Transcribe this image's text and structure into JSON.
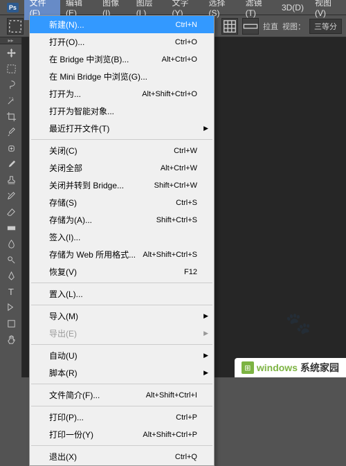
{
  "app": {
    "logo": "Ps"
  },
  "menubar": [
    {
      "label": "文件(F)",
      "active": true
    },
    {
      "label": "编辑(E)"
    },
    {
      "label": "图像(I)"
    },
    {
      "label": "图层(L)"
    },
    {
      "label": "文字(Y)"
    },
    {
      "label": "选择(S)"
    },
    {
      "label": "滤镜(T)"
    },
    {
      "label": "3D(D)"
    },
    {
      "label": "视图(V)"
    }
  ],
  "options_bar": {
    "drag_label": "拉直",
    "view_label": "视图：",
    "view_value": "三等分"
  },
  "file_menu": {
    "groups": [
      [
        {
          "label": "新建(N)...",
          "shortcut": "Ctrl+N",
          "highlighted": true
        },
        {
          "label": "打开(O)...",
          "shortcut": "Ctrl+O"
        },
        {
          "label": "在 Bridge 中浏览(B)...",
          "shortcut": "Alt+Ctrl+O"
        },
        {
          "label": "在 Mini Bridge 中浏览(G)..."
        },
        {
          "label": "打开为...",
          "shortcut": "Alt+Shift+Ctrl+O"
        },
        {
          "label": "打开为智能对象..."
        },
        {
          "label": "最近打开文件(T)",
          "submenu": true
        }
      ],
      [
        {
          "label": "关闭(C)",
          "shortcut": "Ctrl+W"
        },
        {
          "label": "关闭全部",
          "shortcut": "Alt+Ctrl+W"
        },
        {
          "label": "关闭并转到 Bridge...",
          "shortcut": "Shift+Ctrl+W"
        },
        {
          "label": "存储(S)",
          "shortcut": "Ctrl+S"
        },
        {
          "label": "存储为(A)...",
          "shortcut": "Shift+Ctrl+S"
        },
        {
          "label": "签入(I)..."
        },
        {
          "label": "存储为 Web 所用格式...",
          "shortcut": "Alt+Shift+Ctrl+S"
        },
        {
          "label": "恢复(V)",
          "shortcut": "F12"
        }
      ],
      [
        {
          "label": "置入(L)..."
        }
      ],
      [
        {
          "label": "导入(M)",
          "submenu": true
        },
        {
          "label": "导出(E)",
          "submenu": true,
          "disabled": true
        }
      ],
      [
        {
          "label": "自动(U)",
          "submenu": true
        },
        {
          "label": "脚本(R)",
          "submenu": true
        }
      ],
      [
        {
          "label": "文件简介(F)...",
          "shortcut": "Alt+Shift+Ctrl+I"
        }
      ],
      [
        {
          "label": "打印(P)...",
          "shortcut": "Ctrl+P"
        },
        {
          "label": "打印一份(Y)",
          "shortcut": "Alt+Shift+Ctrl+P"
        }
      ],
      [
        {
          "label": "退出(X)",
          "shortcut": "Ctrl+Q"
        }
      ]
    ]
  },
  "watermark": {
    "text1": "windows",
    "text2": "系统家园"
  }
}
